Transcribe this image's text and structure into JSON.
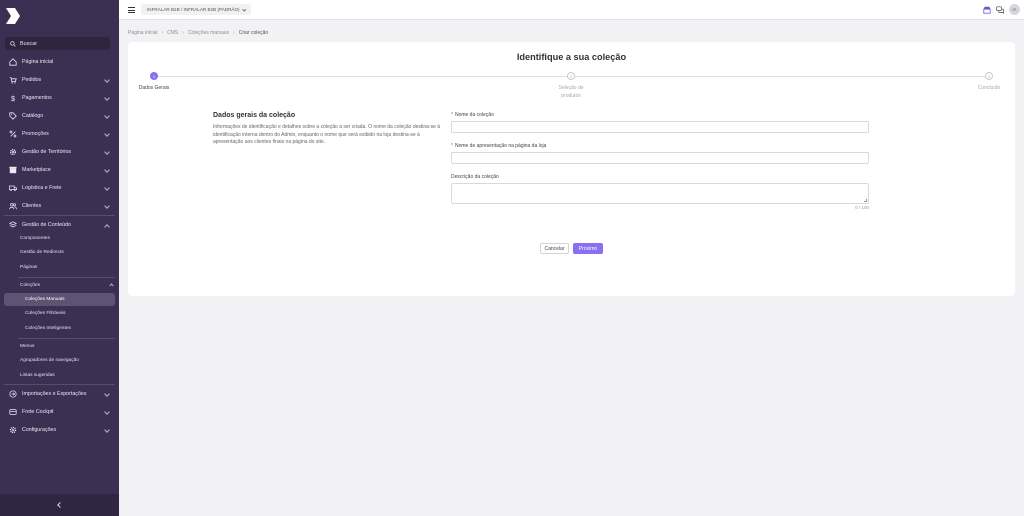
{
  "sidebar": {
    "search_label": "Buscar",
    "items": [
      {
        "label": "Página inicial",
        "icon": "home-icon"
      },
      {
        "label": "Pedidos",
        "icon": "cart-icon"
      },
      {
        "label": "Pagamentos",
        "icon": "dollar-icon"
      },
      {
        "label": "Catálogo",
        "icon": "tag-icon"
      },
      {
        "label": "Promoções",
        "icon": "percent-icon"
      },
      {
        "label": "Gestão de Territórios",
        "icon": "gear-icon"
      },
      {
        "label": "Marketplace",
        "icon": "store-icon"
      },
      {
        "label": "Logística e Frete",
        "icon": "truck-icon"
      },
      {
        "label": "Clientes",
        "icon": "users-icon"
      },
      {
        "label": "Gestão de Conteúdo",
        "icon": "layers-icon"
      }
    ],
    "content_sub": [
      "Componentes",
      "Gestão de Redirects",
      "Páginas"
    ],
    "collections_label": "Coleções",
    "collections_sub": [
      "Coleções Manuais",
      "Coleções Filtráveis",
      "Coleções Inteligentes"
    ],
    "content_sub2": [
      "Menus",
      "Agrupadores de navegação",
      "Listas sugeridas"
    ],
    "bottom_items": [
      {
        "label": "Importações e Exportações",
        "icon": "import-icon"
      },
      {
        "label": "Frete Cockpit",
        "icon": "cockpit-icon"
      },
      {
        "label": "Configurações",
        "icon": "settings-icon"
      }
    ]
  },
  "header": {
    "store": "INFRALAR B2B / INFRALAR B2B (PADRÃO)",
    "avatar_initials": "IA"
  },
  "breadcrumb": [
    "Página inicial",
    "CMS",
    "Coleções manuais",
    "Criar coleção"
  ],
  "page": {
    "title": "Identifique a sua coleção",
    "steps": [
      {
        "number": "1",
        "label": "Dados Gerais"
      },
      {
        "number": "2",
        "label": "Seleção de produtos"
      },
      {
        "number": "3",
        "label": "Concluído"
      }
    ],
    "section_title": "Dados gerais da coleção",
    "section_desc": "Informações de identificação e detalhes sobre a coleção a ser criada. O nome da coleção destina-se à identificação interna dentro do Admin, enquanto o nome que será exibido na loja destina-se à apresentação aos clientes finais na página do site.",
    "fields": {
      "name_label": "Nome da coleção",
      "display_label": "Nome de apresentação na página da loja",
      "desc_label": "Descrição da coleção",
      "counter": "0 / 100",
      "required_mark": "*"
    },
    "cancel_label": "Cancelar",
    "next_label": "Próximo"
  },
  "colors": {
    "sidebar_bg": "#3b3052",
    "accent": "#8a6ff0"
  }
}
